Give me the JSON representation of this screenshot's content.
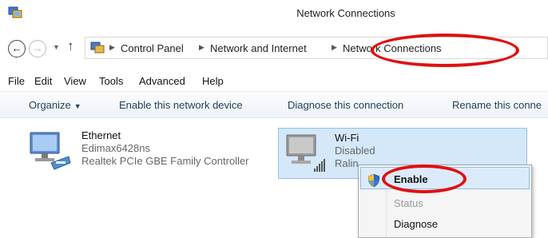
{
  "window": {
    "title": "Network Connections"
  },
  "address_bar": {
    "breadcrumbs": [
      "Control Panel",
      "Network and Internet",
      "Network Connections"
    ]
  },
  "menu": [
    "File",
    "Edit",
    "View",
    "Tools",
    "Advanced",
    "Help"
  ],
  "command_bar": {
    "organize": "Organize",
    "enable_device": "Enable this network device",
    "diagnose": "Diagnose this connection",
    "rename": "Rename this conne"
  },
  "connections": [
    {
      "name": "Ethernet",
      "line2": "Edimax6428ns",
      "line3": "Realtek PCIe GBE Family Controller"
    },
    {
      "name": "Wi-Fi",
      "line2": "Disabled",
      "line3": "Ralin"
    }
  ],
  "context_menu": {
    "items": [
      "Enable",
      "Status",
      "Diagnose"
    ]
  },
  "colors": {
    "annotation": "#e01010",
    "selection": "#d4e8fa",
    "command_text": "#1e3b5a"
  },
  "icons": {
    "app": "network-connections-icon",
    "back": "back-arrow-icon",
    "forward": "forward-arrow-icon",
    "up": "up-arrow-icon",
    "ethernet": "ethernet-adapter-icon",
    "wifi": "wifi-adapter-icon",
    "uac": "uac-shield-icon"
  }
}
